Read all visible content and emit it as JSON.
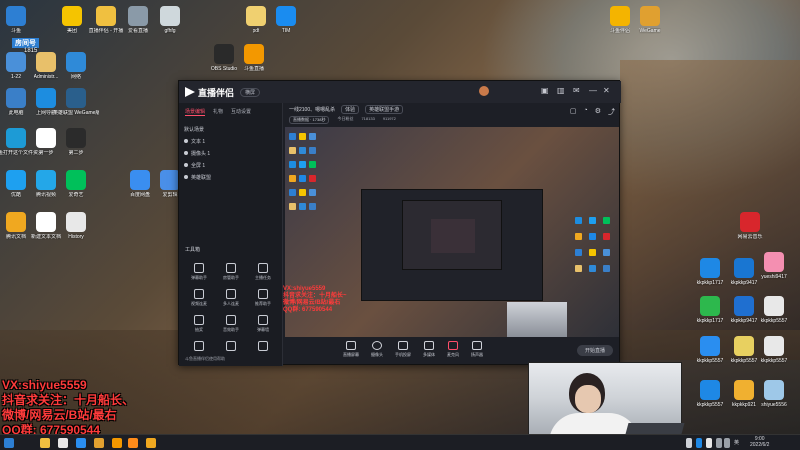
{
  "desktop": {
    "icons_left": [
      {
        "label": "斗鱼",
        "color": "#2d7fd3"
      },
      {
        "label": "美团",
        "color": "#f5c400"
      },
      {
        "label": "1-22",
        "color": "#4a90d9"
      },
      {
        "label": "Administr...",
        "color": "#e8c06a"
      },
      {
        "label": "网络",
        "color": "#2f8ad8"
      },
      {
        "label": "此电脑",
        "color": "#3a7fc8"
      },
      {
        "label": "上网导航",
        "color": "#1d8de0"
      },
      {
        "label": "英雄联盟 WeGame版",
        "color": "#2a5f8c"
      },
      {
        "label": "摸鱼打开这个文件资源管理器",
        "color": "#1d9bd6"
      },
      {
        "label": "第一步",
        "color": "#ffffff"
      },
      {
        "label": "第二步",
        "color": "#2b2b2b"
      },
      {
        "label": "优酷",
        "color": "#1ea0f0"
      },
      {
        "label": "腾讯视频",
        "color": "#24a7e8"
      },
      {
        "label": "爱奇艺",
        "color": "#00c05a"
      },
      {
        "label": "腾讯文档",
        "color": "#f0a820"
      },
      {
        "label": "新建文本文档",
        "color": "#ffffff"
      },
      {
        "label": "History",
        "color": "#e8e8e8"
      },
      {
        "label": "直播伴侣 - 开播",
        "color": "#f0c040"
      },
      {
        "label": "爱看直播",
        "color": "#8a9aa8"
      },
      {
        "label": "gfhfg",
        "color": "#cfd8dc"
      },
      {
        "label": "pdf",
        "color": "#f0d070"
      },
      {
        "label": "TIM",
        "color": "#1a8cf0"
      },
      {
        "label": "百度网盘",
        "color": "#3a8ef0"
      },
      {
        "label": "爱剪辑",
        "color": "#4a8fe8"
      },
      {
        "label": "OBS Studio",
        "color": "#2a2a2a"
      },
      {
        "label": "斗鱼直播",
        "color": "#f39800"
      },
      {
        "label": "斗鱼伴侣",
        "color": "#f4b400"
      }
    ],
    "badge_count": "1815",
    "channel_label": "房间号",
    "icons_right": [
      {
        "label": "WeGame",
        "color": "#e0a030"
      },
      {
        "label": "网易云音乐",
        "color": "#d8262c"
      },
      {
        "label": "kkpkkp1717",
        "color": "#1e88e5"
      },
      {
        "label": "kkpkkp9417",
        "color": "#1976d2"
      },
      {
        "label": "yueshi9417",
        "color": "#f48fb1"
      },
      {
        "label": "kkpkkp1717",
        "color": "#2db84d"
      },
      {
        "label": "kkpkkp9417",
        "color": "#1f6fd0"
      },
      {
        "label": "kkpkkp5557",
        "color": "#e8e8e8"
      },
      {
        "label": "kkpkkp5557",
        "color": "#2a8ef0"
      },
      {
        "label": "kkpkkp5557",
        "color": "#e8d060"
      },
      {
        "label": "kkpkkp5557",
        "color": "#e8e8e8"
      },
      {
        "label": "kkpkkp5557",
        "color": "#1e88e5"
      },
      {
        "label": "kkpkkp921",
        "color": "#f0b030"
      },
      {
        "label": "shiyue5556",
        "color": "#9ec8e8"
      }
    ]
  },
  "app": {
    "logo_text": "直播伴侣",
    "mode_badge": "横屏",
    "sidebar_tabs": [
      "场景编辑",
      "礼物",
      "互动设置"
    ],
    "scene_items": [
      "默认场景",
      "文本 1",
      "摄像头 1",
      "全屏 1",
      "英雄联盟"
    ],
    "tool_title": "工具箱",
    "tools": [
      "弹幕助手",
      "房管助手",
      "主播任务",
      "视频连麦",
      "多人连麦",
      "推荐助手",
      "抽奖",
      "音效助手",
      "弹幕墙",
      "",
      "",
      ""
    ],
    "side_footer": "斗鱼直播伴侣使用帮助",
    "room_title": "一线2100、嗯嗯乱杀",
    "room_tag": "体验",
    "category": "英雄联盟手游",
    "stats": [
      "直播数据 · 1738秒",
      "今日粉丝",
      "718133",
      "911972"
    ],
    "preview_overlay": [
      "VX:shiyue5559",
      "抖音求关注：十月船长~",
      "微博/网易云/B站/最右",
      "QQ群: 677590544"
    ],
    "bottom_tools": [
      "直播屏幕",
      "摄像头",
      "手机投屏",
      "多媒体",
      "麦克风",
      "扬声器"
    ],
    "live_button": "开始直播"
  },
  "overlay_text": [
    "VX:shiyue5559",
    "抖音求关注：十月船长、",
    "微博/网易云/B站/最右",
    "QQ群: 677590544"
  ],
  "taskbar": {
    "lang": "英",
    "time": "9:00",
    "date": "2022/6/2"
  }
}
